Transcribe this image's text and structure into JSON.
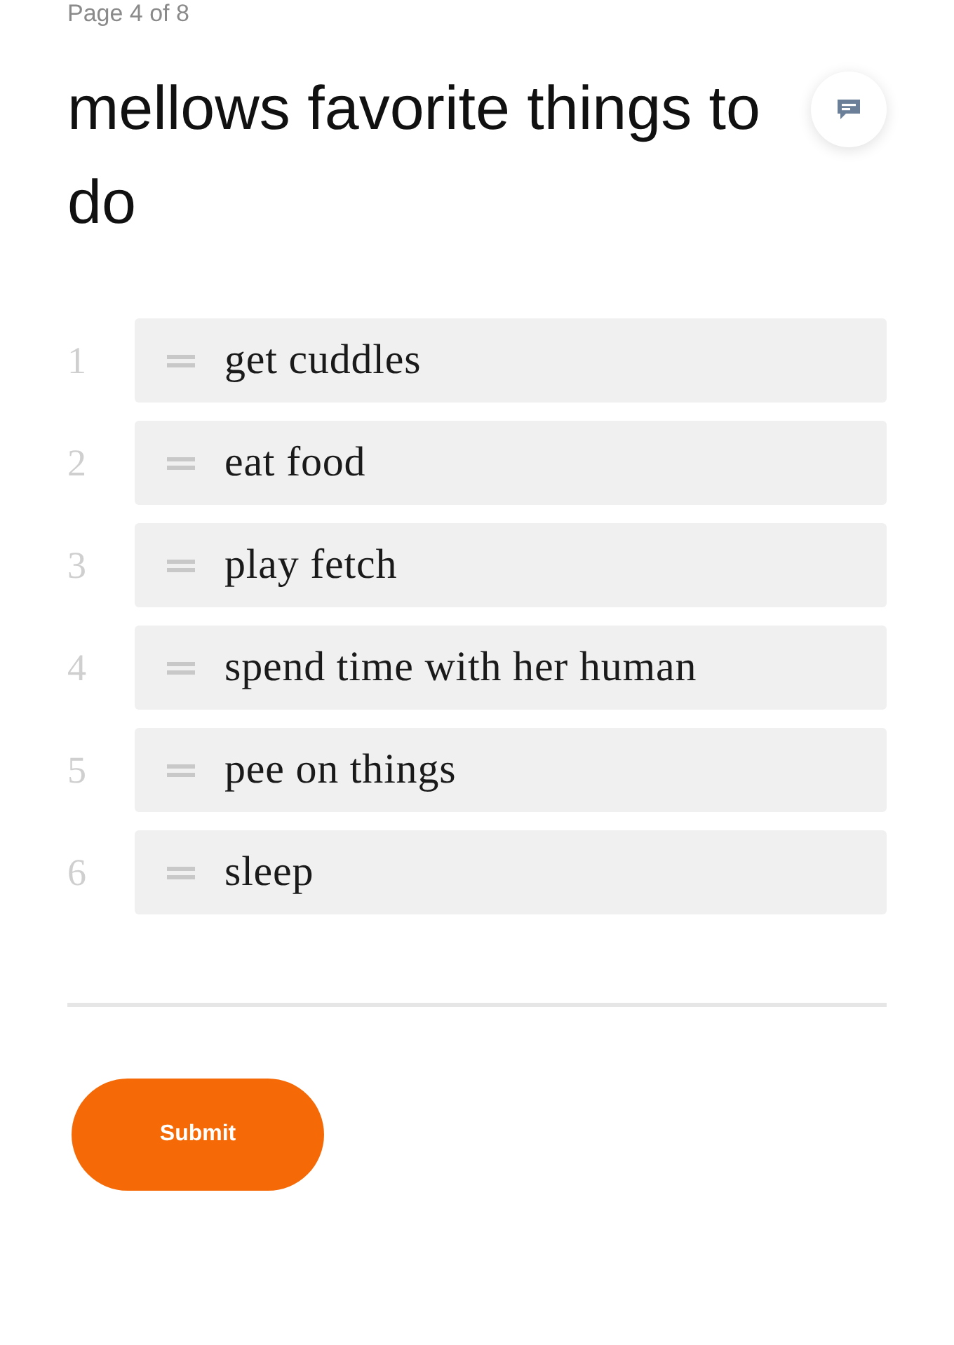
{
  "page_indicator": "Page 4 of 8",
  "title": "mellows favorite things to do",
  "ranking": {
    "items": [
      {
        "number": "1",
        "label": "get cuddles"
      },
      {
        "number": "2",
        "label": "eat food"
      },
      {
        "number": "3",
        "label": "play fetch"
      },
      {
        "number": "4",
        "label": "spend time with her human"
      },
      {
        "number": "5",
        "label": "pee on things"
      },
      {
        "number": "6",
        "label": "sleep"
      }
    ]
  },
  "submit_button": {
    "label": "Submit"
  }
}
